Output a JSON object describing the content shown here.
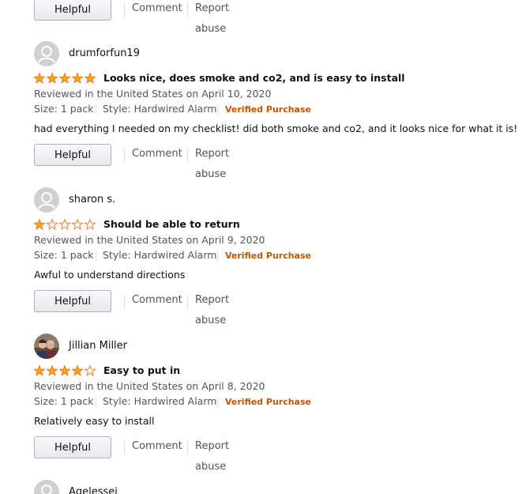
{
  "actions": {
    "helpful_label": "Helpful",
    "comment_label": "Comment",
    "report_label": "Report abuse"
  },
  "icons": {
    "star_color": "#ffa41c",
    "star_outline": "#de7921",
    "avatar_bg": "#d0d0d0",
    "avatar_fg": "#ffffff"
  },
  "reviews": [
    {
      "name": "drumforfun19",
      "avatar": "default-avatar-icon",
      "rating": 5,
      "title": "Looks nice, does smoke and co2, and is easy to install",
      "date": "Reviewed in the United States on April 10, 2020",
      "size": "Size: 1 pack",
      "style": "Style: Hardwired Alarm",
      "verified": "Verified Purchase",
      "body": "had everything I needed on my checklist! did both smoke and co2, and it looks nice for what it is!"
    },
    {
      "name": "sharon s.",
      "avatar": "default-avatar-icon",
      "rating": 1,
      "title": "Should be able to return",
      "date": "Reviewed in the United States on April 9, 2020",
      "size": "Size: 1 pack",
      "style": "Style: Hardwired Alarm",
      "verified": "Verified Purchase",
      "body": "Awful to understand directions"
    },
    {
      "name": "Jillian Miller",
      "avatar": "photo-avatar-icon",
      "rating": 4,
      "title": "Easy to put in",
      "date": "Reviewed in the United States on April 8, 2020",
      "size": "Size: 1 pack",
      "style": "Style: Hardwired Alarm",
      "verified": "Verified Purchase",
      "body": "Relatively easy to install"
    },
    {
      "name": "Agelessei",
      "avatar": "default-avatar-icon"
    }
  ]
}
